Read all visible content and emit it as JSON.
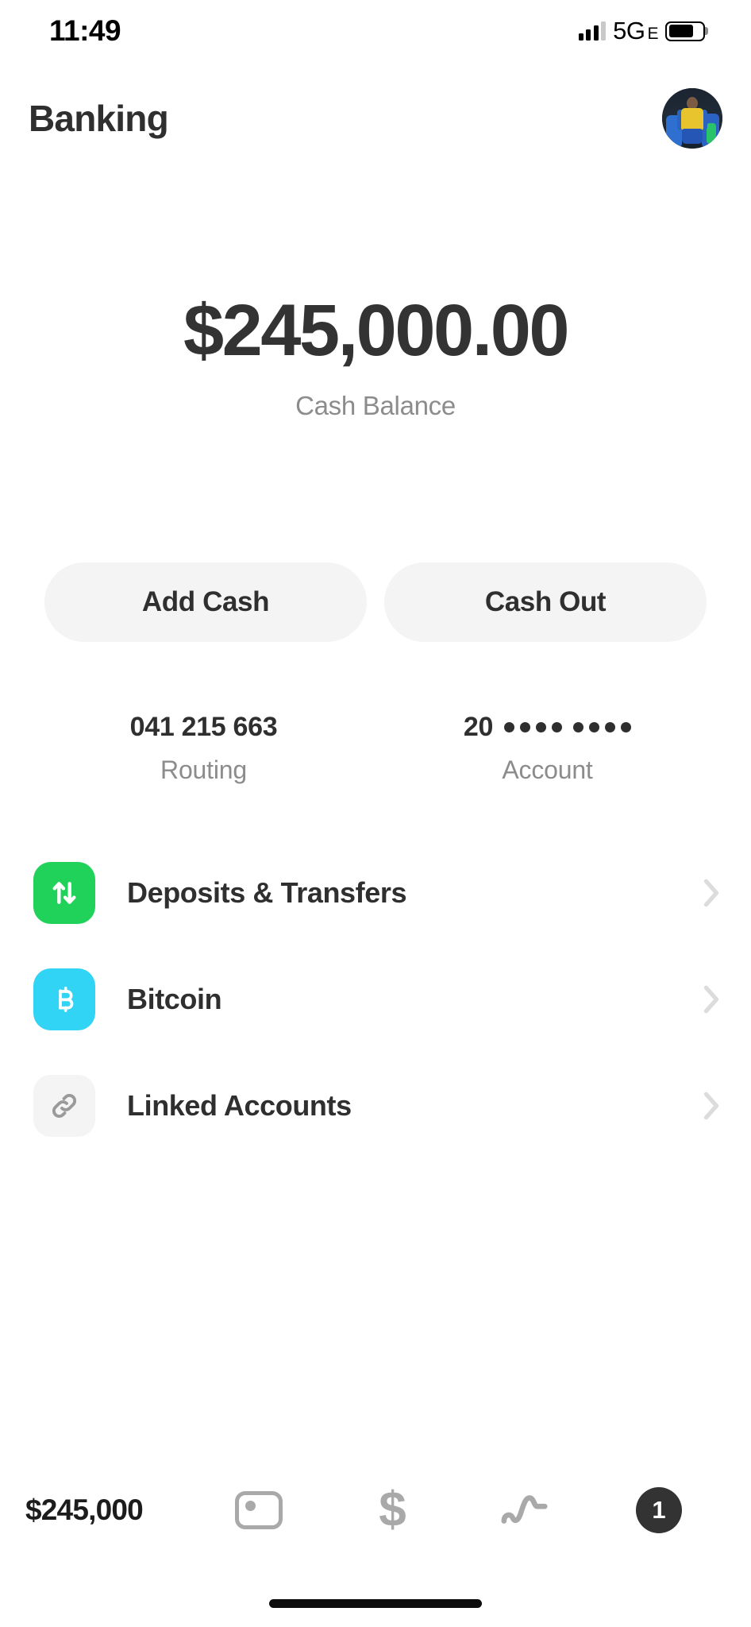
{
  "status_bar": {
    "time": "11:49",
    "network": "5G",
    "network_sub": "E",
    "signal_icon": "signal-bars-icon",
    "battery_icon": "battery-icon",
    "battery_level_percent": 75
  },
  "header": {
    "title": "Banking",
    "avatar_icon": "avatar"
  },
  "balance": {
    "amount": "$245,000.00",
    "label": "Cash Balance"
  },
  "actions": {
    "add_cash_label": "Add Cash",
    "cash_out_label": "Cash Out"
  },
  "account_details": {
    "routing": {
      "value": "041 215 663",
      "label": "Routing"
    },
    "account": {
      "prefix": "20",
      "masked": "•••• ••••",
      "label": "Account"
    }
  },
  "list": {
    "items": [
      {
        "label": "Deposits & Transfers",
        "icon": "transfer-arrows-icon",
        "icon_bg": "#20d25a",
        "icon_fg": "#ffffff",
        "chevron": "chevron-right-icon"
      },
      {
        "label": "Bitcoin",
        "icon": "bitcoin-icon",
        "icon_bg": "#31d4f5",
        "icon_fg": "#ffffff",
        "chevron": "chevron-right-icon"
      },
      {
        "label": "Linked Accounts",
        "icon": "link-chain-icon",
        "icon_bg": "#f4f4f4",
        "icon_fg": "#9a9a9a",
        "chevron": "chevron-right-icon"
      }
    ]
  },
  "tab_bar": {
    "balance": "$245,000",
    "card_icon": "cash-card-icon",
    "payments_icon": "dollar-sign-icon",
    "investing_icon": "activity-squiggle-icon",
    "notifications_badge": "1"
  },
  "colors": {
    "text_primary": "#2f2f2f",
    "text_secondary": "#8c8c8c",
    "button_bg": "#f4f4f4",
    "green": "#20d25a",
    "cyan": "#31d4f5",
    "badge_dark": "#333333",
    "icon_gray": "#a9a9a9",
    "chevron_gray": "#dcdcdc"
  }
}
